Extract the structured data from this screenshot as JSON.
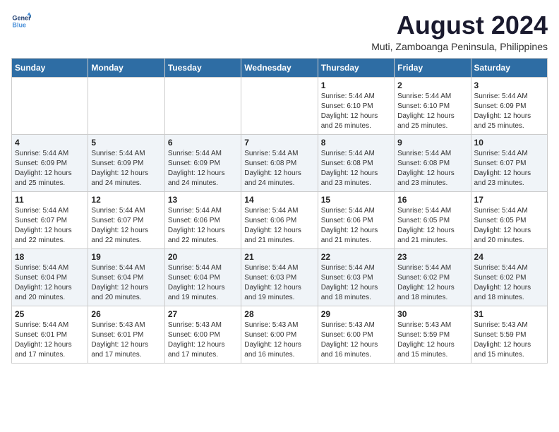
{
  "logo": {
    "line1": "General",
    "line2": "Blue"
  },
  "title": "August 2024",
  "subtitle": "Muti, Zamboanga Peninsula, Philippines",
  "days_header": [
    "Sunday",
    "Monday",
    "Tuesday",
    "Wednesday",
    "Thursday",
    "Friday",
    "Saturday"
  ],
  "weeks": [
    [
      {
        "day": "",
        "info": ""
      },
      {
        "day": "",
        "info": ""
      },
      {
        "day": "",
        "info": ""
      },
      {
        "day": "",
        "info": ""
      },
      {
        "day": "1",
        "info": "Sunrise: 5:44 AM\nSunset: 6:10 PM\nDaylight: 12 hours\nand 26 minutes."
      },
      {
        "day": "2",
        "info": "Sunrise: 5:44 AM\nSunset: 6:10 PM\nDaylight: 12 hours\nand 25 minutes."
      },
      {
        "day": "3",
        "info": "Sunrise: 5:44 AM\nSunset: 6:09 PM\nDaylight: 12 hours\nand 25 minutes."
      }
    ],
    [
      {
        "day": "4",
        "info": "Sunrise: 5:44 AM\nSunset: 6:09 PM\nDaylight: 12 hours\nand 25 minutes."
      },
      {
        "day": "5",
        "info": "Sunrise: 5:44 AM\nSunset: 6:09 PM\nDaylight: 12 hours\nand 24 minutes."
      },
      {
        "day": "6",
        "info": "Sunrise: 5:44 AM\nSunset: 6:09 PM\nDaylight: 12 hours\nand 24 minutes."
      },
      {
        "day": "7",
        "info": "Sunrise: 5:44 AM\nSunset: 6:08 PM\nDaylight: 12 hours\nand 24 minutes."
      },
      {
        "day": "8",
        "info": "Sunrise: 5:44 AM\nSunset: 6:08 PM\nDaylight: 12 hours\nand 23 minutes."
      },
      {
        "day": "9",
        "info": "Sunrise: 5:44 AM\nSunset: 6:08 PM\nDaylight: 12 hours\nand 23 minutes."
      },
      {
        "day": "10",
        "info": "Sunrise: 5:44 AM\nSunset: 6:07 PM\nDaylight: 12 hours\nand 23 minutes."
      }
    ],
    [
      {
        "day": "11",
        "info": "Sunrise: 5:44 AM\nSunset: 6:07 PM\nDaylight: 12 hours\nand 22 minutes."
      },
      {
        "day": "12",
        "info": "Sunrise: 5:44 AM\nSunset: 6:07 PM\nDaylight: 12 hours\nand 22 minutes."
      },
      {
        "day": "13",
        "info": "Sunrise: 5:44 AM\nSunset: 6:06 PM\nDaylight: 12 hours\nand 22 minutes."
      },
      {
        "day": "14",
        "info": "Sunrise: 5:44 AM\nSunset: 6:06 PM\nDaylight: 12 hours\nand 21 minutes."
      },
      {
        "day": "15",
        "info": "Sunrise: 5:44 AM\nSunset: 6:06 PM\nDaylight: 12 hours\nand 21 minutes."
      },
      {
        "day": "16",
        "info": "Sunrise: 5:44 AM\nSunset: 6:05 PM\nDaylight: 12 hours\nand 21 minutes."
      },
      {
        "day": "17",
        "info": "Sunrise: 5:44 AM\nSunset: 6:05 PM\nDaylight: 12 hours\nand 20 minutes."
      }
    ],
    [
      {
        "day": "18",
        "info": "Sunrise: 5:44 AM\nSunset: 6:04 PM\nDaylight: 12 hours\nand 20 minutes."
      },
      {
        "day": "19",
        "info": "Sunrise: 5:44 AM\nSunset: 6:04 PM\nDaylight: 12 hours\nand 20 minutes."
      },
      {
        "day": "20",
        "info": "Sunrise: 5:44 AM\nSunset: 6:04 PM\nDaylight: 12 hours\nand 19 minutes."
      },
      {
        "day": "21",
        "info": "Sunrise: 5:44 AM\nSunset: 6:03 PM\nDaylight: 12 hours\nand 19 minutes."
      },
      {
        "day": "22",
        "info": "Sunrise: 5:44 AM\nSunset: 6:03 PM\nDaylight: 12 hours\nand 18 minutes."
      },
      {
        "day": "23",
        "info": "Sunrise: 5:44 AM\nSunset: 6:02 PM\nDaylight: 12 hours\nand 18 minutes."
      },
      {
        "day": "24",
        "info": "Sunrise: 5:44 AM\nSunset: 6:02 PM\nDaylight: 12 hours\nand 18 minutes."
      }
    ],
    [
      {
        "day": "25",
        "info": "Sunrise: 5:44 AM\nSunset: 6:01 PM\nDaylight: 12 hours\nand 17 minutes."
      },
      {
        "day": "26",
        "info": "Sunrise: 5:43 AM\nSunset: 6:01 PM\nDaylight: 12 hours\nand 17 minutes."
      },
      {
        "day": "27",
        "info": "Sunrise: 5:43 AM\nSunset: 6:00 PM\nDaylight: 12 hours\nand 17 minutes."
      },
      {
        "day": "28",
        "info": "Sunrise: 5:43 AM\nSunset: 6:00 PM\nDaylight: 12 hours\nand 16 minutes."
      },
      {
        "day": "29",
        "info": "Sunrise: 5:43 AM\nSunset: 6:00 PM\nDaylight: 12 hours\nand 16 minutes."
      },
      {
        "day": "30",
        "info": "Sunrise: 5:43 AM\nSunset: 5:59 PM\nDaylight: 12 hours\nand 15 minutes."
      },
      {
        "day": "31",
        "info": "Sunrise: 5:43 AM\nSunset: 5:59 PM\nDaylight: 12 hours\nand 15 minutes."
      }
    ]
  ]
}
